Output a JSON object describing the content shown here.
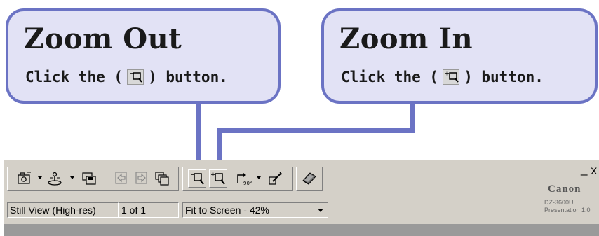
{
  "callouts": {
    "zoom_out": {
      "title": "Zoom Out",
      "instruction_before": "Click the (",
      "instruction_after": ") button.",
      "icon": "zoom-out-icon"
    },
    "zoom_in": {
      "title": "Zoom In",
      "instruction_before": "Click the (",
      "instruction_after": ") button.",
      "icon": "zoom-in-icon"
    }
  },
  "toolbar": {
    "buttons": [
      {
        "name": "capture-button",
        "icon": "camera-icon",
        "has_dropdown": true
      },
      {
        "name": "camera-settings-button",
        "icon": "joystick-icon",
        "has_dropdown": true
      },
      {
        "name": "save-button",
        "icon": "save-icon",
        "has_dropdown": false
      },
      {
        "name": "previous-image-button",
        "icon": "previous-icon",
        "has_dropdown": false
      },
      {
        "name": "next-image-button",
        "icon": "next-icon",
        "has_dropdown": false
      },
      {
        "name": "multi-view-button",
        "icon": "windows-icon",
        "has_dropdown": false
      },
      {
        "name": "zoom-out-button",
        "icon": "zoom-out-icon",
        "has_dropdown": false
      },
      {
        "name": "zoom-in-button",
        "icon": "zoom-in-icon",
        "has_dropdown": false
      },
      {
        "name": "rotate-button",
        "icon": "rotate-90-icon",
        "has_dropdown": true
      },
      {
        "name": "draw-button",
        "icon": "pen-icon",
        "has_dropdown": false
      },
      {
        "name": "help-button",
        "icon": "help-book-icon",
        "has_dropdown": false
      }
    ]
  },
  "status": {
    "view_mode": "Still View (High-res)",
    "page_indicator": "1 of 1",
    "zoom_select": "Fit to Screen - 42%"
  },
  "window": {
    "minimize": "_",
    "close": "X"
  },
  "branding": {
    "brand": "Canon",
    "model": "DZ-3600U",
    "product": "Presentation 1.0"
  },
  "colors": {
    "callout_fill": "#e2e2f5",
    "callout_border": "#6b73c4",
    "toolbar_bg": "#d4d0c8"
  }
}
